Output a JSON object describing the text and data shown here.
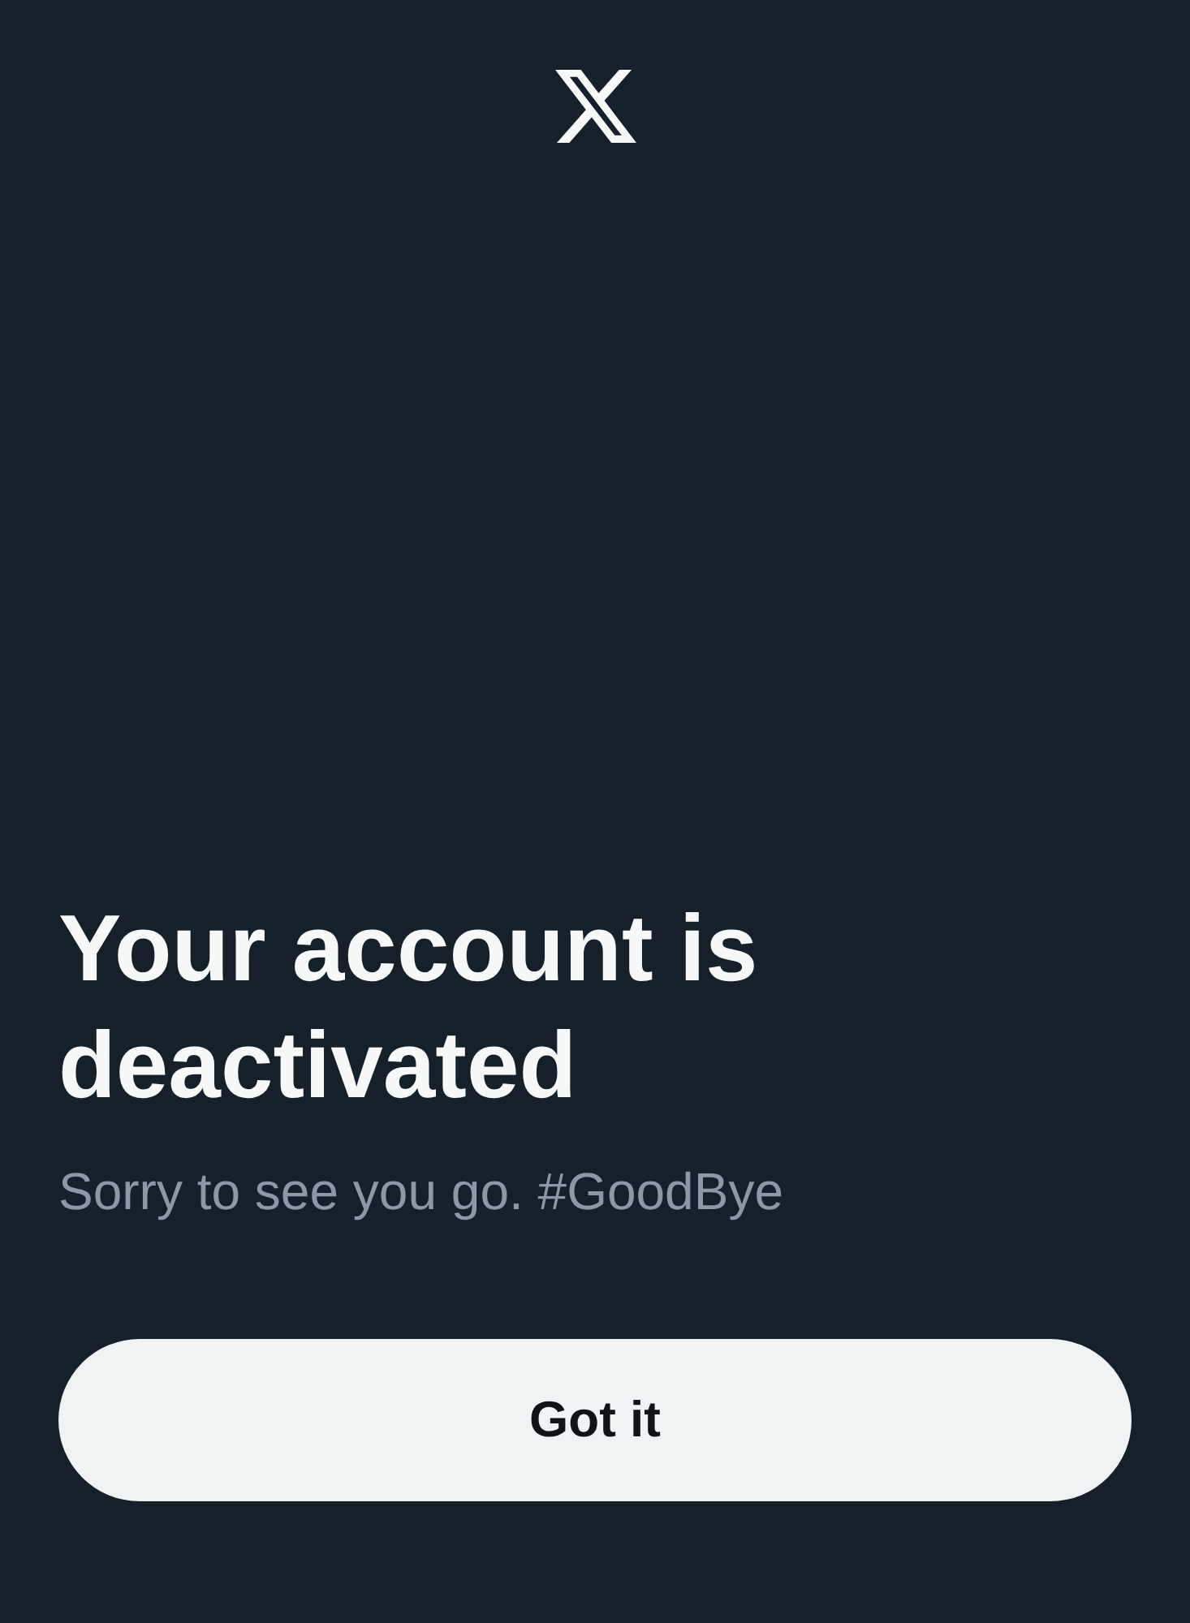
{
  "heading": "Your account is deactivated",
  "message": "Sorry to see you go. #GoodBye",
  "button": {
    "label": "Got it"
  }
}
